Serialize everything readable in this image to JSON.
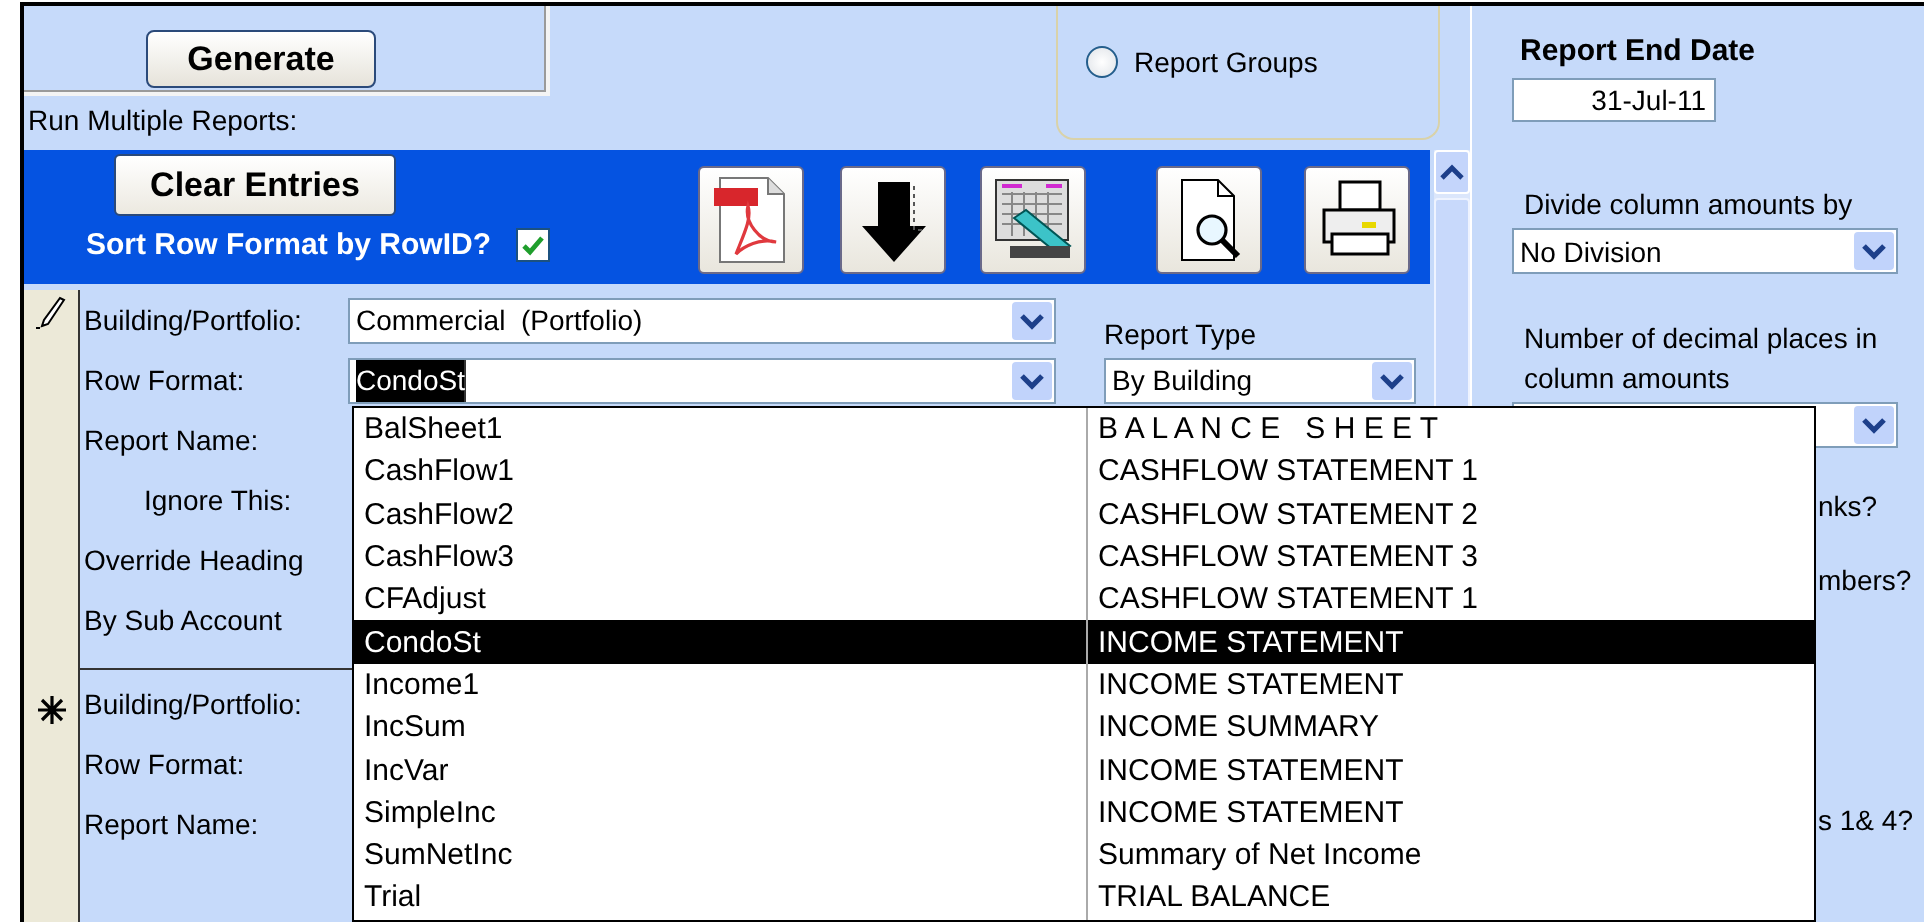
{
  "generate_button": "Generate",
  "run_multiple_label": "Run Multiple Reports:",
  "report_source": [
    {
      "label": "Report Groups",
      "selected": false
    }
  ],
  "toolbar": {
    "clear_button": "Clear Entries",
    "sort_label": "Sort Row Format by RowID?",
    "sort_checked": true
  },
  "records": [
    {
      "kind": "editing",
      "fields": [
        {
          "kind": "combo",
          "label": "Building/Portfolio:",
          "value": "Commercial  (Portfolio)",
          "text_selected": false
        },
        {
          "kind": "combo",
          "label": "Row Format:",
          "value": "CondoSt",
          "text_selected": true
        },
        {
          "kind": "label",
          "label": "Report Name:"
        },
        {
          "kind": "indented",
          "label": "Ignore This:"
        },
        {
          "kind": "label",
          "label": "Override Heading"
        },
        {
          "kind": "label",
          "label": "By Sub Account"
        }
      ],
      "report_type": {
        "label": "Report Type",
        "value": "By Building"
      }
    },
    {
      "kind": "new",
      "fields": [
        {
          "kind": "label",
          "label": "Building/Portfolio:"
        },
        {
          "kind": "label",
          "label": "Row Format:"
        },
        {
          "kind": "label",
          "label": "Report Name:"
        }
      ]
    }
  ],
  "dropdown": {
    "rows": [
      {
        "code": "BalSheet1",
        "title": "B A L A N C E   S H E E T",
        "selected": false
      },
      {
        "code": "CashFlow1",
        "title": "CASHFLOW STATEMENT 1",
        "selected": false
      },
      {
        "code": "CashFlow2",
        "title": "CASHFLOW STATEMENT 2",
        "selected": false
      },
      {
        "code": "CashFlow3",
        "title": "CASHFLOW STATEMENT 3",
        "selected": false
      },
      {
        "code": "CFAdjust",
        "title": "CASHFLOW STATEMENT 1",
        "selected": false
      },
      {
        "code": "CondoSt",
        "title": "INCOME STATEMENT",
        "selected": true
      },
      {
        "code": "Income1",
        "title": "INCOME STATEMENT",
        "selected": false
      },
      {
        "code": "IncSum",
        "title": "INCOME SUMMARY",
        "selected": false
      },
      {
        "code": "IncVar",
        "title": "INCOME STATEMENT",
        "selected": false
      },
      {
        "code": "SimpleInc",
        "title": "INCOME STATEMENT",
        "selected": false
      },
      {
        "code": "SumNetInc",
        "title": "Summary of Net Income",
        "selected": false
      },
      {
        "code": "Trial",
        "title": "TRIAL BALANCE",
        "selected": false
      }
    ]
  },
  "options": {
    "end_date_label": "Report End Date",
    "end_date": "31-Jul-11",
    "divide_label": "Divide column amounts by",
    "divide_value": "No Division",
    "decimals_label": "Number of decimal places in column amounts",
    "partial_labels": [
      "nks?",
      "mbers?",
      "s 1& 4?"
    ]
  }
}
